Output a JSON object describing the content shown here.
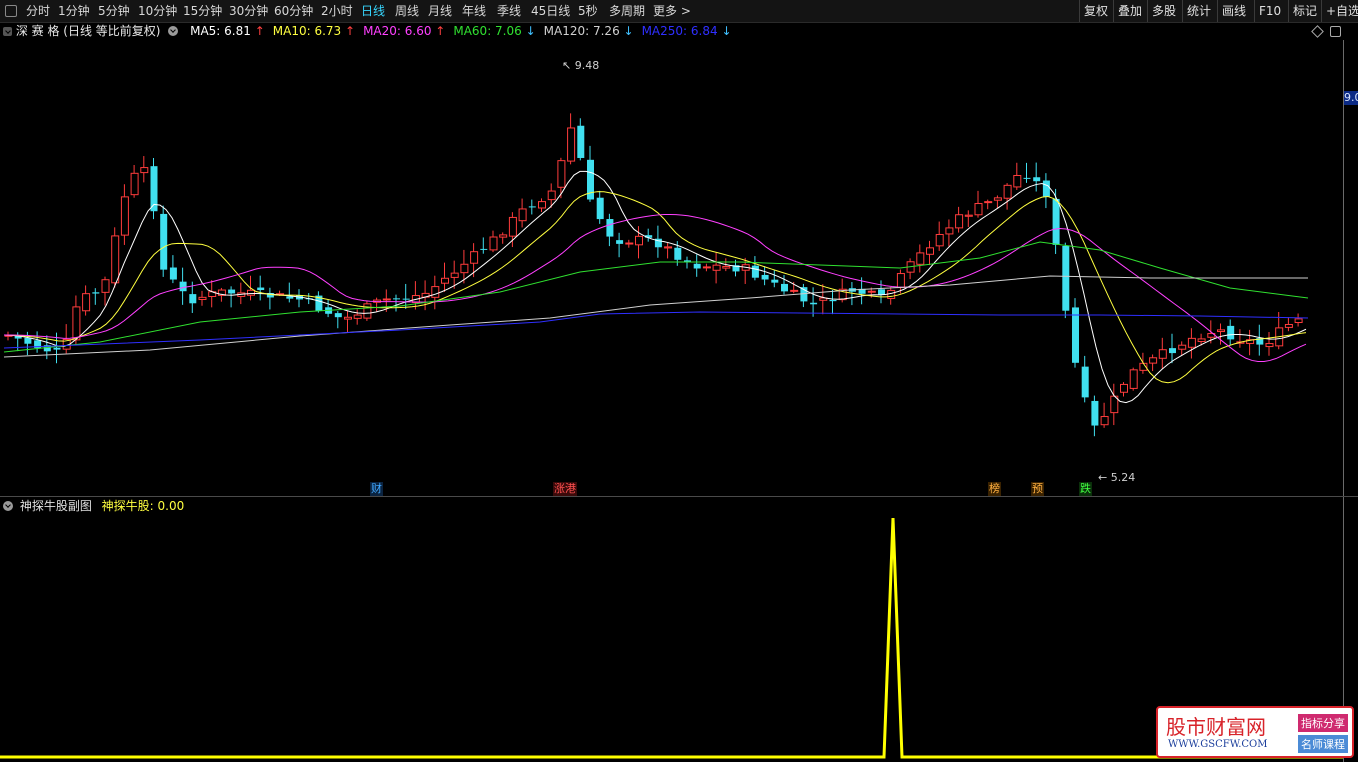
{
  "toolbar": {
    "left_items": [
      "分时",
      "1分钟",
      "5分钟",
      "10分钟",
      "15分钟",
      "30分钟",
      "60分钟",
      "2小时",
      "日线",
      "周线",
      "月线",
      "年线",
      "季线",
      "45日线",
      "5秒",
      "多周期",
      "更多 >"
    ],
    "active_index": 8,
    "right_items": [
      "复权",
      "叠加",
      "多股",
      "统计",
      "画线",
      "F10",
      "标记",
      "+自选"
    ]
  },
  "main_chart": {
    "title": "深 赛 格 (日线 等比前复权)",
    "ma_legend": [
      {
        "label": "MA5: 6.81",
        "arrow": "↑",
        "color": "#ffffff"
      },
      {
        "label": "MA10: 6.73",
        "arrow": "↑",
        "color": "#ffff40"
      },
      {
        "label": "MA20: 6.60",
        "arrow": "↑",
        "color": "#ff40ff"
      },
      {
        "label": "MA60: 7.06",
        "arrow": "↓",
        "color": "#30e030"
      },
      {
        "label": "MA120: 7.26",
        "arrow": "↓",
        "color": "#d0d0d0"
      },
      {
        "label": "MA250: 6.84",
        "arrow": "↓",
        "color": "#2f2fff"
      }
    ],
    "high_note": "9.48",
    "low_note": "5.24",
    "scale_price": "9.0",
    "markers": [
      {
        "text": "财",
        "color": "#40a8ff",
        "bg": "#0a2340"
      },
      {
        "text": "涨港",
        "color": "#ff5050",
        "bg": "#3a0a0a"
      },
      {
        "text": "榜",
        "color": "#ffb040",
        "bg": "#3a2200"
      },
      {
        "text": "预",
        "color": "#ffb040",
        "bg": "#3a2200"
      },
      {
        "text": "跌",
        "color": "#40ff40",
        "bg": "#0a300a"
      }
    ]
  },
  "sub_chart": {
    "title": "神探牛股副图",
    "indicator_label": "神探牛股: 0.00",
    "series_color": "#ffff00"
  },
  "chart_data": {
    "type": "candlestick",
    "series_name": "神探牛股",
    "subchart_values_note": "0 everywhere except a single spike to 1",
    "subchart_spike_value": 1
  },
  "watermark": {
    "title": "股市财富网",
    "url": "WWW.GSCFW.COM",
    "tag1": "指标分享",
    "tag2": "名师课程"
  }
}
